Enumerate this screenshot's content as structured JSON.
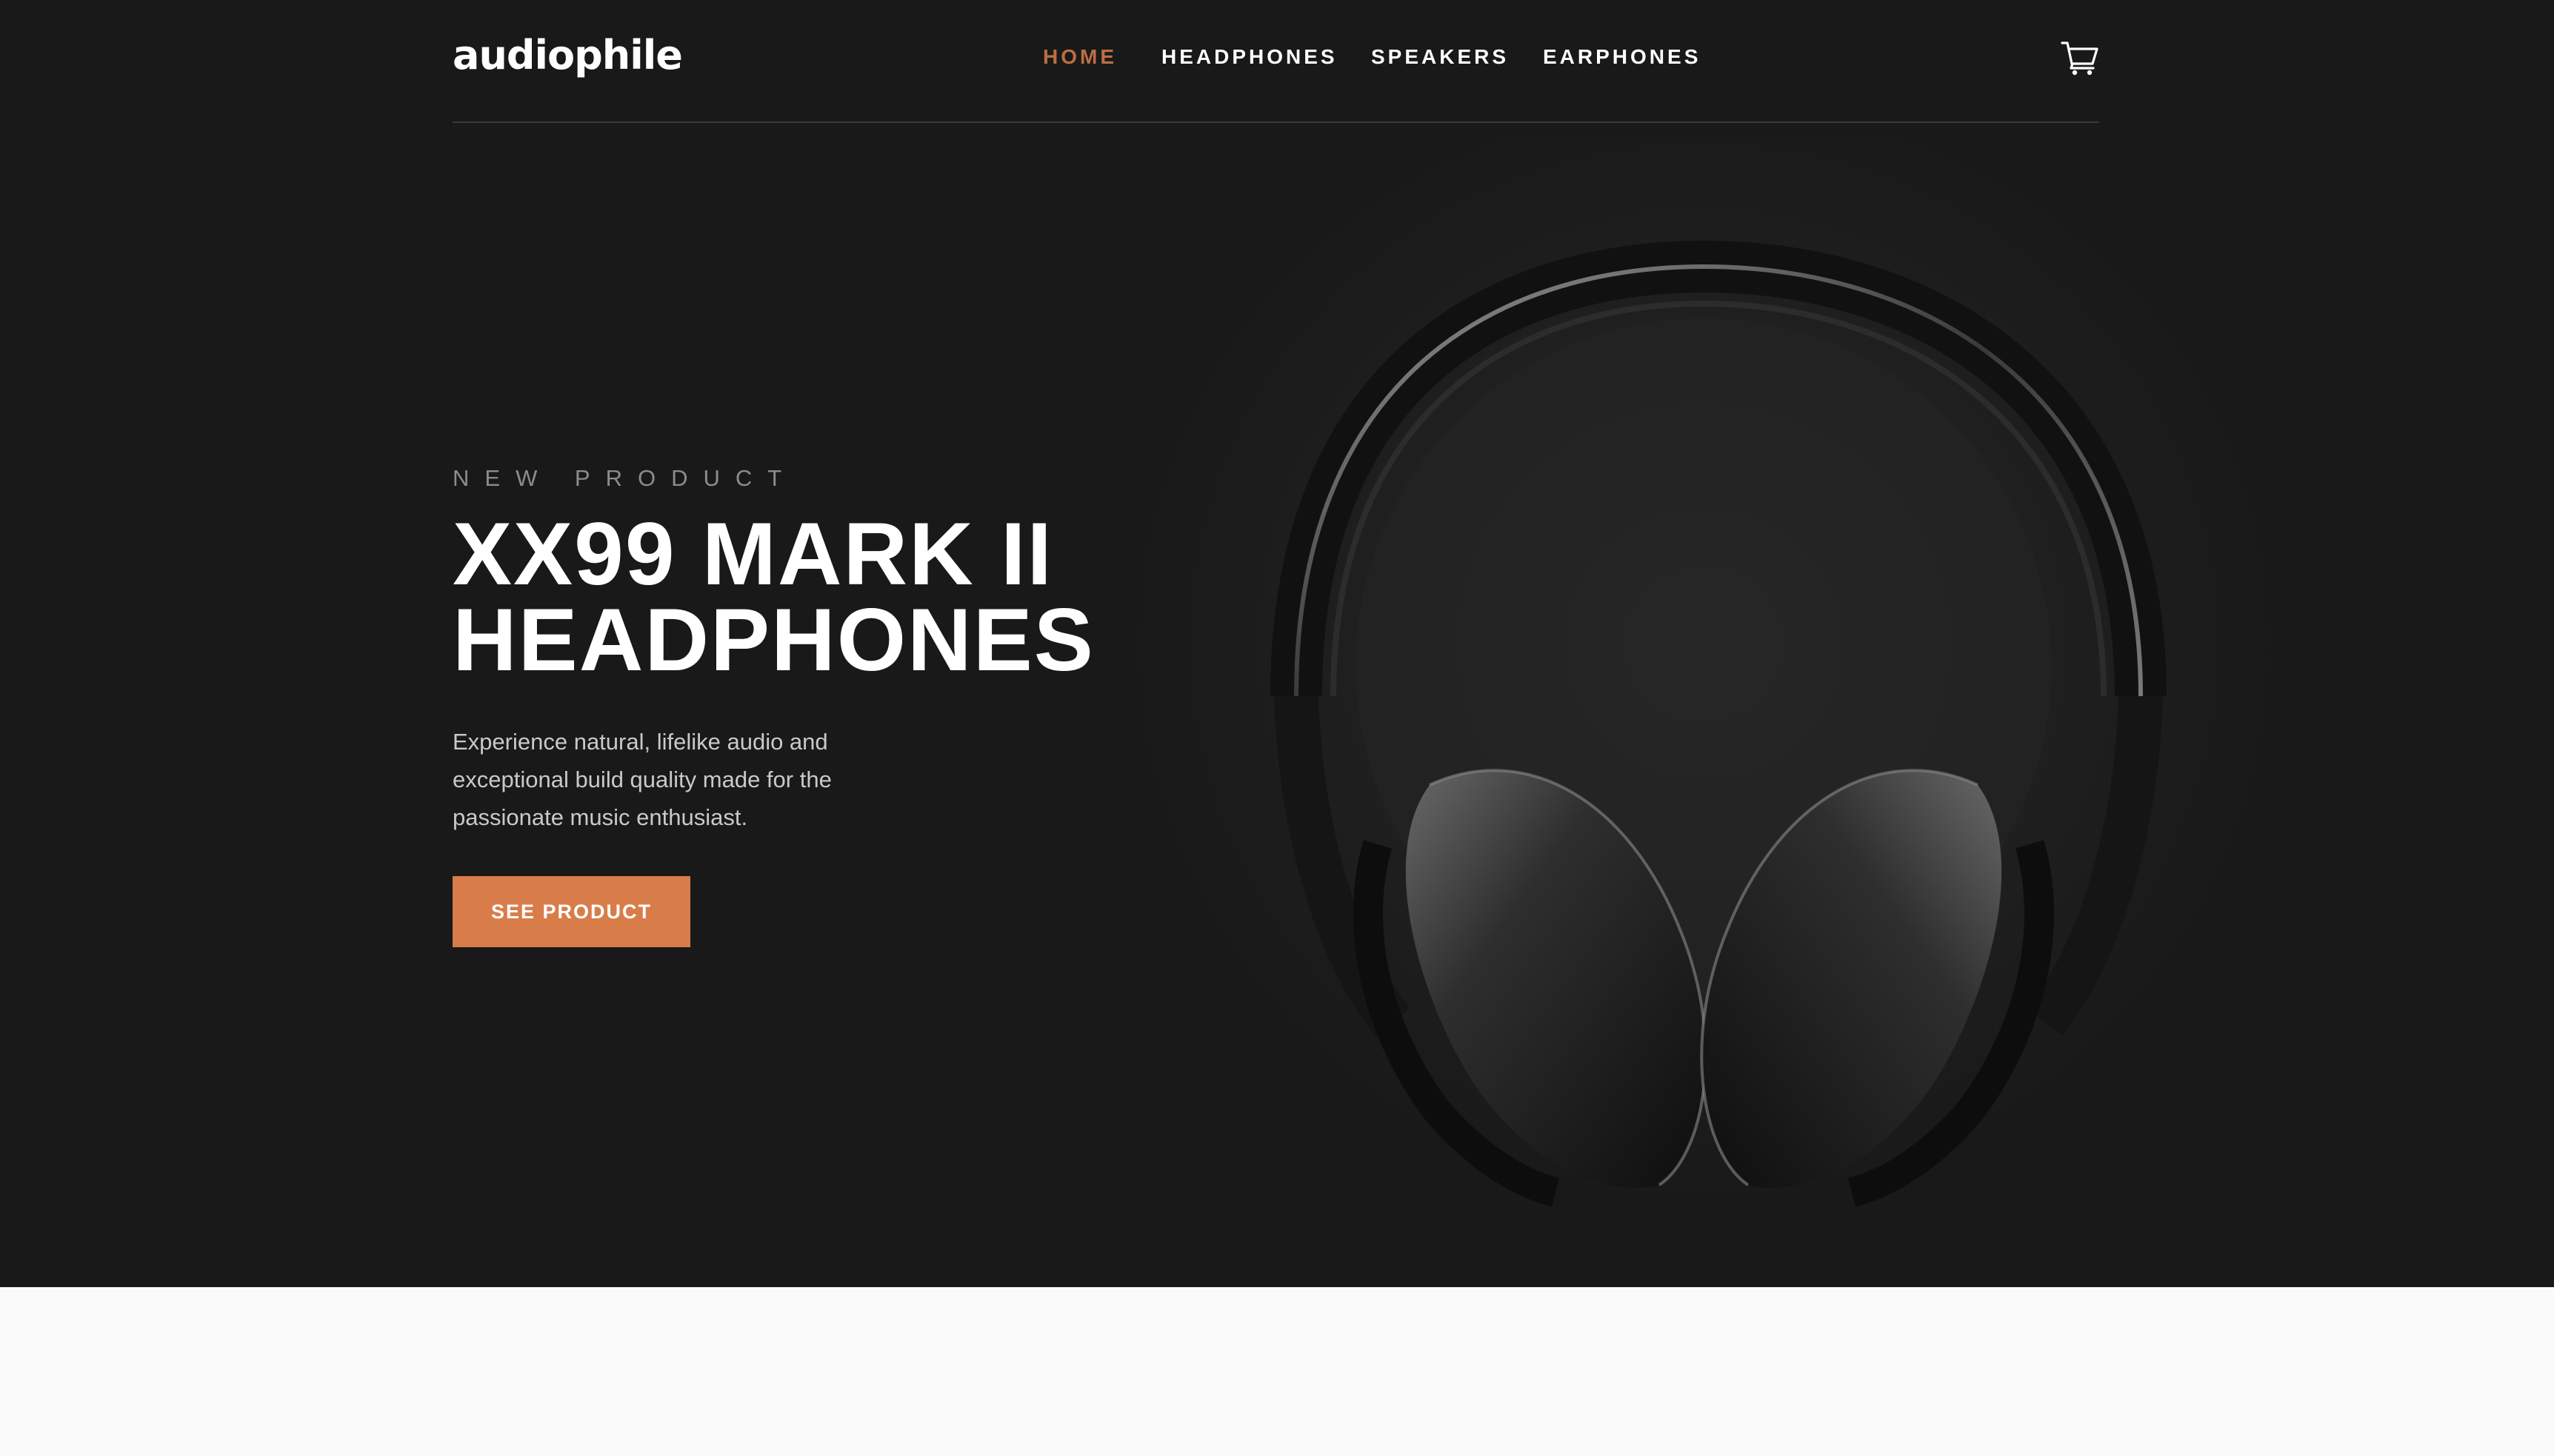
{
  "brand": {
    "logo": "audiophile"
  },
  "nav": {
    "items": [
      {
        "label": "HOME",
        "active": true
      },
      {
        "label": "HEADPHONES",
        "active": false
      },
      {
        "label": "SPEAKERS",
        "active": false
      },
      {
        "label": "EARPHONES",
        "active": false
      }
    ]
  },
  "header": {
    "cart_icon": "cart-icon"
  },
  "hero": {
    "overline": "NEW PRODUCT",
    "title_line1": "XX99 MARK II",
    "title_line2": "HEADPHONES",
    "description": "Experience natural, lifelike audio and exceptional build quality made for the passionate music enthusiast.",
    "cta_label": "SEE PRODUCT",
    "image_icon": "headphones-image"
  },
  "colors": {
    "accent": "#d87d4a",
    "hero_bg": "#191919",
    "page_bg": "#fafafa",
    "text_primary": "#ffffff",
    "text_secondary": "#c9c9c9"
  }
}
